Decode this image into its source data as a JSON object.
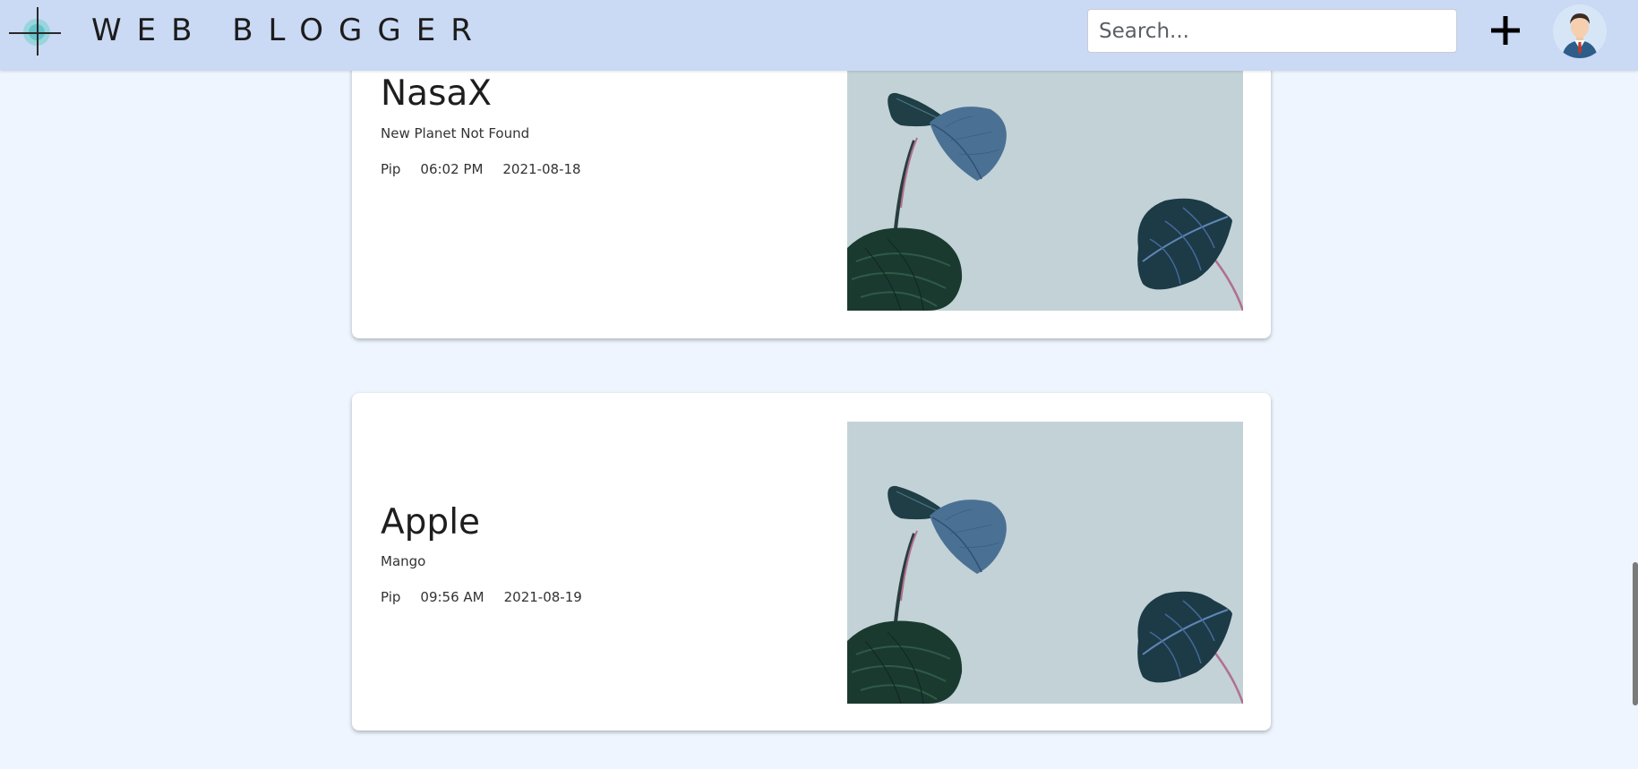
{
  "brand": {
    "title": "WEB BLOGGER",
    "logo_icon": "crosshair-logo-icon"
  },
  "search": {
    "placeholder": "Search..."
  },
  "actions": {
    "add_icon": "plus-icon",
    "avatar_icon": "user-avatar-icon"
  },
  "posts": [
    {
      "title": "NasaX",
      "subtitle": "New Planet Not Found",
      "author": "Pip",
      "time": "06:02 PM",
      "date": "2021-08-18",
      "image": "plant-leaves-image"
    },
    {
      "title": "Apple",
      "subtitle": "Mango",
      "author": "Pip",
      "time": "09:56 AM",
      "date": "2021-08-19",
      "image": "plant-leaves-image"
    }
  ],
  "colors": {
    "navbar": "#cad9f4",
    "page_bg": "#eef5fe",
    "image_bg": "#c3d2d7"
  }
}
